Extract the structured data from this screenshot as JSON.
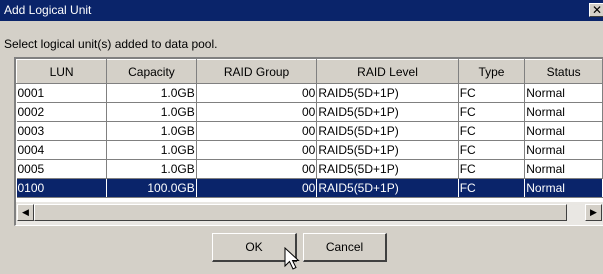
{
  "window": {
    "title": "Add Logical Unit",
    "close_glyph": "✕"
  },
  "prompt": "Select logical unit(s) added to data pool.",
  "table": {
    "columns": [
      "LUN",
      "Capacity",
      "RAID Group",
      "RAID Level",
      "Type",
      "Status"
    ],
    "rows": [
      [
        "0001",
        "1.0GB",
        "00",
        "RAID5(5D+1P)",
        "FC",
        "Normal"
      ],
      [
        "0002",
        "1.0GB",
        "00",
        "RAID5(5D+1P)",
        "FC",
        "Normal"
      ],
      [
        "0003",
        "1.0GB",
        "00",
        "RAID5(5D+1P)",
        "FC",
        "Normal"
      ],
      [
        "0004",
        "1.0GB",
        "00",
        "RAID5(5D+1P)",
        "FC",
        "Normal"
      ],
      [
        "0005",
        "1.0GB",
        "00",
        "RAID5(5D+1P)",
        "FC",
        "Normal"
      ],
      [
        "0100",
        "100.0GB",
        "00",
        "RAID5(5D+1P)",
        "FC",
        "Normal"
      ]
    ],
    "selected_row_index": 5
  },
  "scrollbar": {
    "left_arrow": "◀",
    "right_arrow": "▶"
  },
  "buttons": {
    "ok": "OK",
    "cancel": "Cancel"
  },
  "colors": {
    "titlebar": "#0a246a",
    "selection": "#0a246a",
    "face": "#d4d0c8"
  }
}
